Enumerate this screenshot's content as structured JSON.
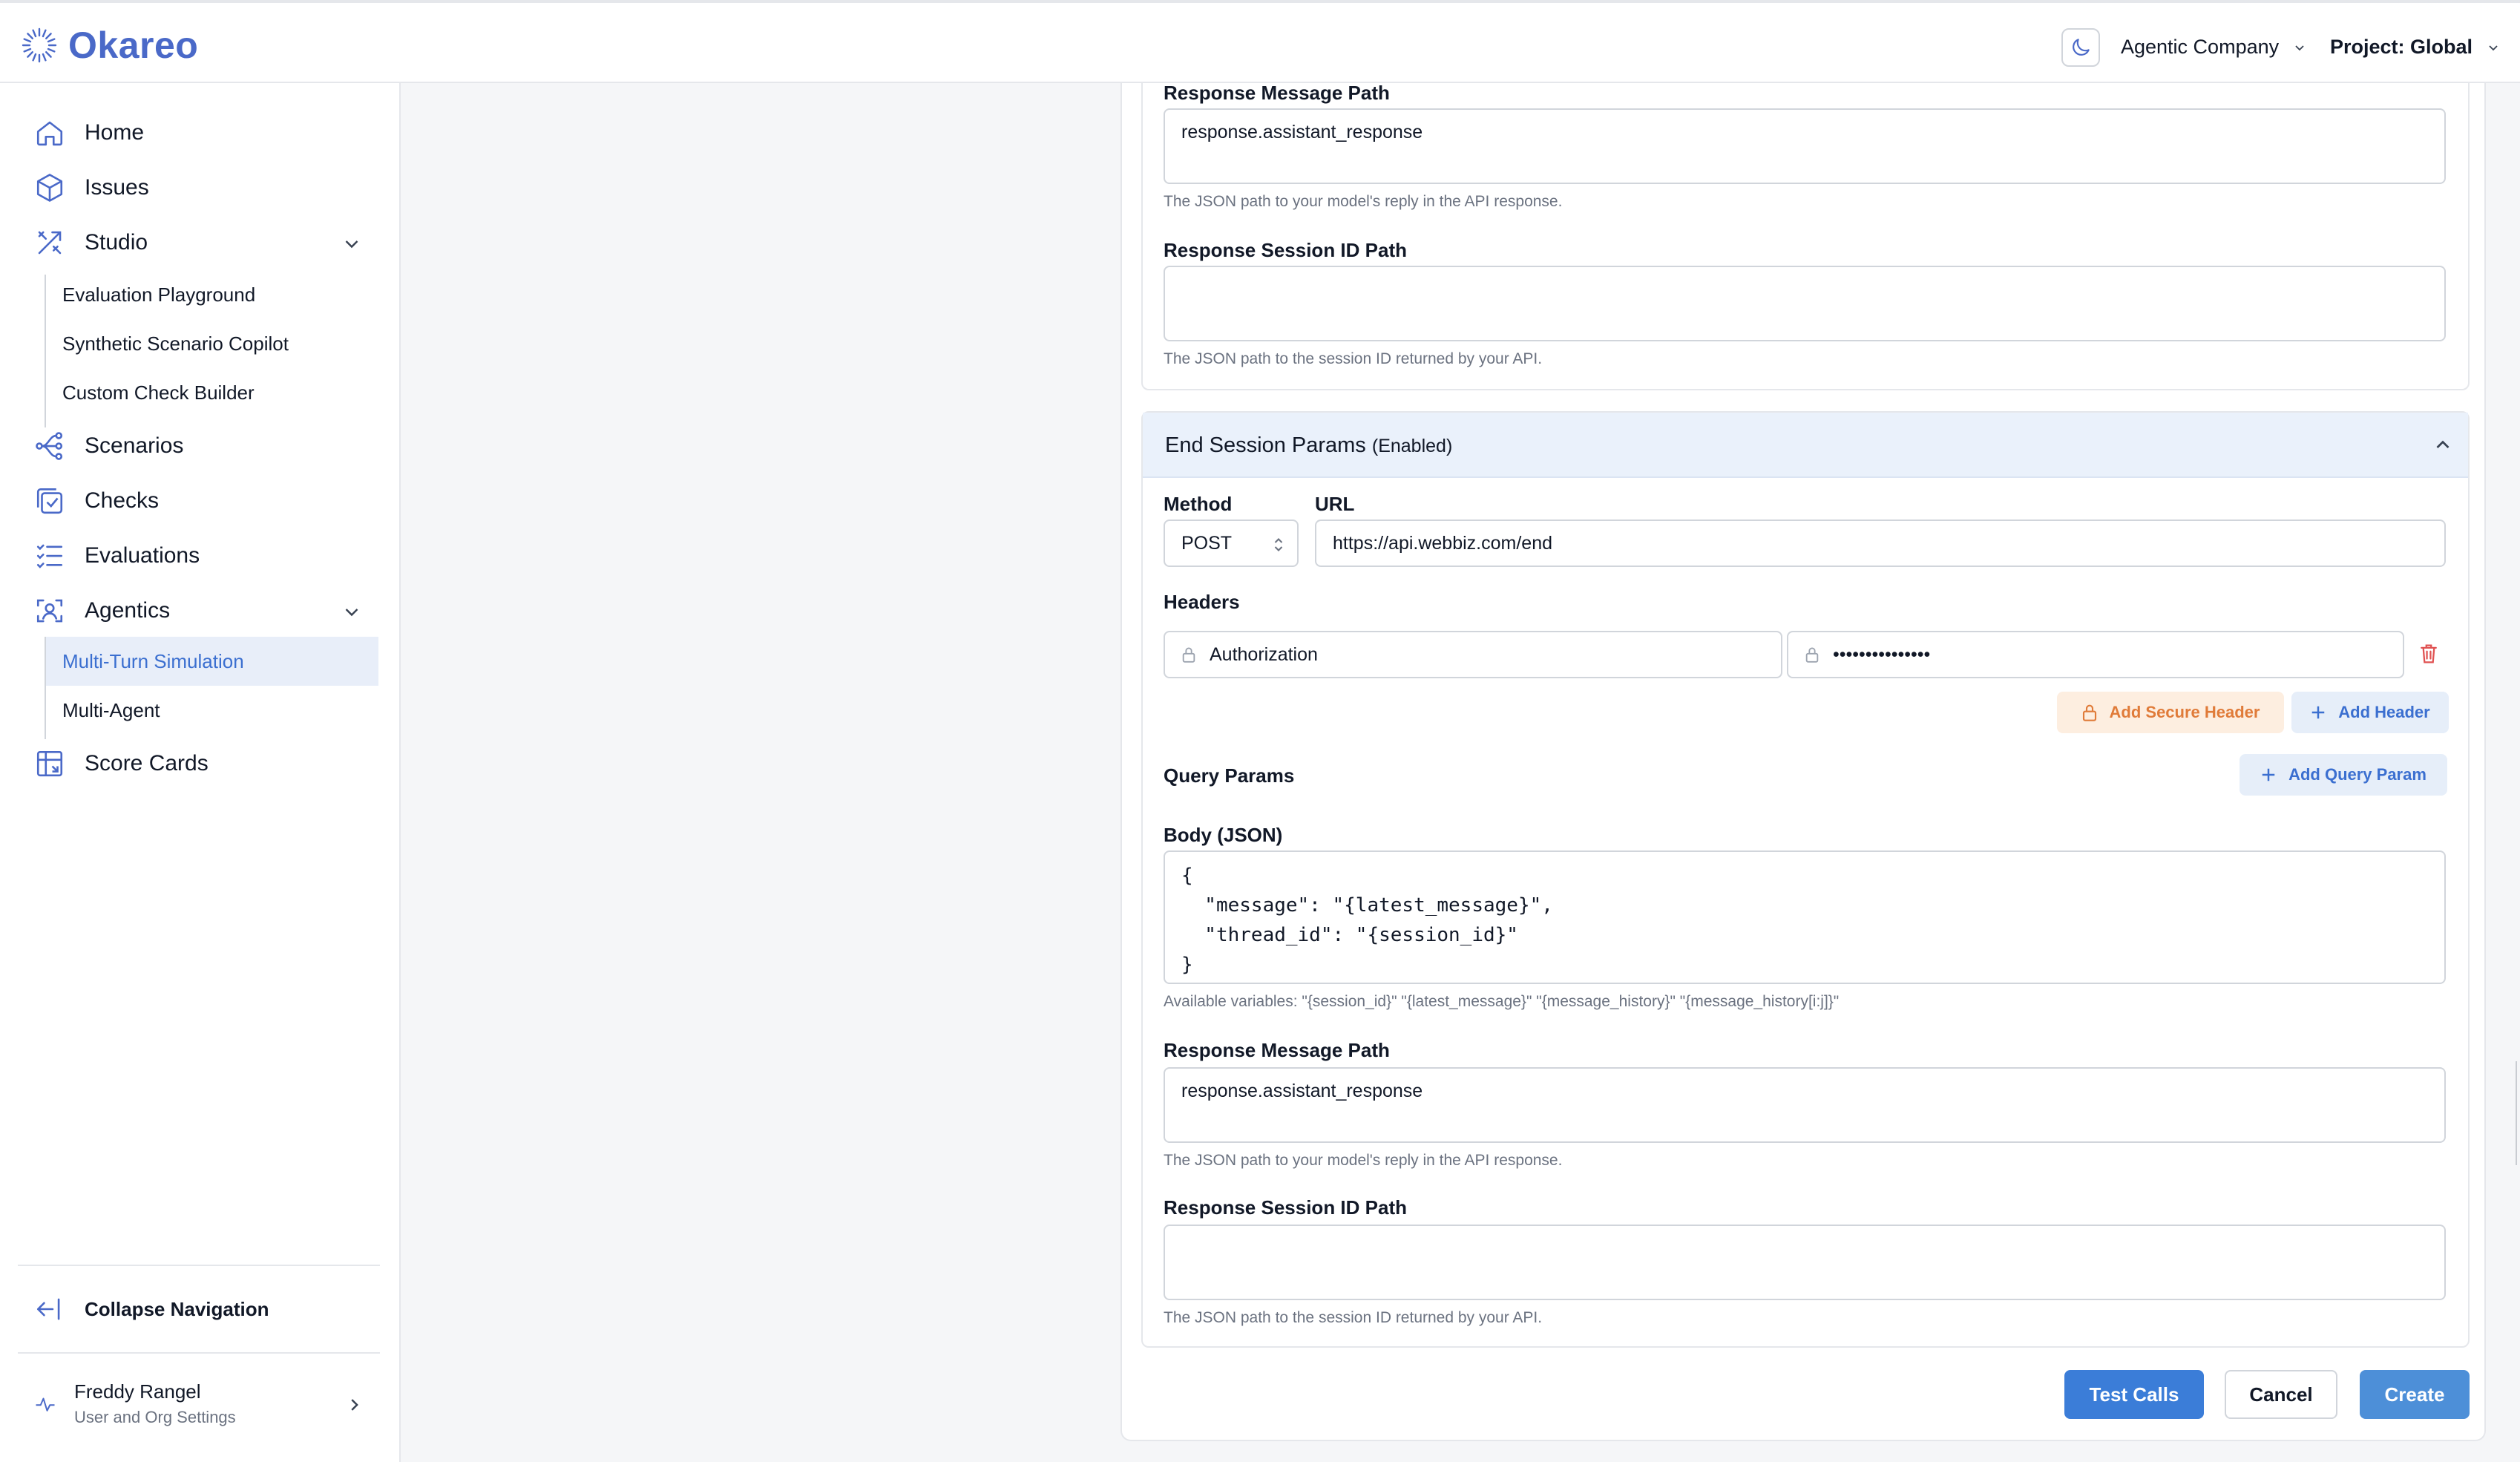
{
  "header": {
    "logo_text": "Okareo",
    "company": "Agentic Company",
    "project": "Project: Global"
  },
  "sidebar": {
    "items": [
      {
        "label": "Home",
        "icon": "home-icon"
      },
      {
        "label": "Issues",
        "icon": "cube-icon"
      },
      {
        "label": "Studio",
        "icon": "tools-icon"
      },
      {
        "label": "Scenarios",
        "icon": "branch-icon"
      },
      {
        "label": "Checks",
        "icon": "check-square-icon"
      },
      {
        "label": "Evaluations",
        "icon": "list-check-icon"
      },
      {
        "label": "Agentics",
        "icon": "agent-scan-icon"
      },
      {
        "label": "Score Cards",
        "icon": "table-icon"
      }
    ],
    "studio_sub": [
      "Evaluation Playground",
      "Synthetic Scenario Copilot",
      "Custom Check Builder"
    ],
    "agentics_sub": [
      "Multi-Turn Simulation",
      "Multi-Agent"
    ],
    "collapse_label": "Collapse Navigation",
    "user": {
      "name": "Freddy Rangel",
      "subtitle": "User and Org Settings"
    }
  },
  "form": {
    "top": {
      "response_message_label": "Response Message Path",
      "response_message_value": "response.assistant_response",
      "response_message_help": "The JSON path to your model's reply in the API response.",
      "session_id_label": "Response Session ID Path",
      "session_id_value": "",
      "session_id_help": "The JSON path to the session ID returned by your API."
    },
    "end_session": {
      "title": "End Session Params",
      "status": "(Enabled)",
      "method_label": "Method",
      "method_value": "POST",
      "url_label": "URL",
      "url_value": "https://api.webbiz.com/end",
      "headers_label": "Headers",
      "header_key": "Authorization",
      "header_value": "•••••••••••••••",
      "add_secure_header": "Add Secure Header",
      "add_header": "Add Header",
      "query_params_label": "Query Params",
      "add_query_param": "Add Query Param",
      "body_label": "Body (JSON)",
      "body_value": "{\n  \"message\": \"{latest_message}\",\n  \"thread_id\": \"{session_id}\"\n}",
      "available_vars": "Available variables: \"{session_id}\" \"{latest_message}\" \"{message_history}\" \"{message_history[i:j]}\"",
      "response_message_label": "Response Message Path",
      "response_message_value": "response.assistant_response",
      "response_message_help": "The JSON path to your model's reply in the API response.",
      "session_id_label": "Response Session ID Path",
      "session_id_value": "",
      "session_id_help": "The JSON path to the session ID returned by your API."
    },
    "actions": {
      "test": "Test Calls",
      "cancel": "Cancel",
      "create": "Create"
    }
  },
  "colors": {
    "brand": "#4a69c8",
    "accent": "#3b7dd8",
    "active_bg": "#e8eef9",
    "secure": "#e07b39",
    "danger": "#e05252"
  }
}
